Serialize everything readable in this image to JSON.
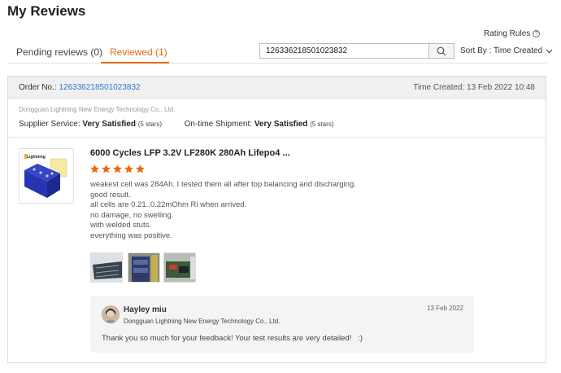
{
  "page": {
    "title": "My Reviews"
  },
  "header": {
    "rating_rules": "Rating Rules",
    "help_icon_glyph": "?"
  },
  "tabs": [
    {
      "label": "Pending reviews (0)"
    },
    {
      "label": "Reviewed (1)"
    }
  ],
  "search": {
    "value": "126336218501023832",
    "icon": "search-icon"
  },
  "sort": {
    "label": "Sort By : Time Created",
    "icon": "chevron-down-icon"
  },
  "order": {
    "label": "Order No.:",
    "number": "126336218501023832",
    "time_created": "Time Created: 13 Feb 2022 10:48",
    "supplier": "Dongguan Lightning New Energy Technology Co., Ltd.",
    "supplier_service_label": "Supplier Service:",
    "supplier_service_value": "Very Satisfied",
    "supplier_service_stars": "(5 stars)",
    "shipment_label": "On-time Shipment:",
    "shipment_value": "Very Satisfied",
    "shipment_stars": "(5 stars)"
  },
  "product": {
    "title": "6000 Cycles LFP 3.2V LF280K 280Ah Lifepo4 ...",
    "rating": 5,
    "review_lines": [
      "weakest cell was 284Ah. I tested them all after top balancing and discharging.",
      "good result.",
      "all cells are 0.21..0.22mOhm Ri when arrived.",
      "no damage, no swelling.",
      "with welded stuts.",
      "everything was positive."
    ],
    "logo_text": "Lightning"
  },
  "reply": {
    "name": "Hayley miu",
    "company": "Dongguan Lightning New Energy Technology Co., Ltd.",
    "date": "13 Feb 2022",
    "text": "Thank you so much for your feedback! Your test results are very detailed!   :)"
  },
  "colors": {
    "accent": "#e96b10",
    "link": "#2d7ac9",
    "star": "#e96b10"
  }
}
